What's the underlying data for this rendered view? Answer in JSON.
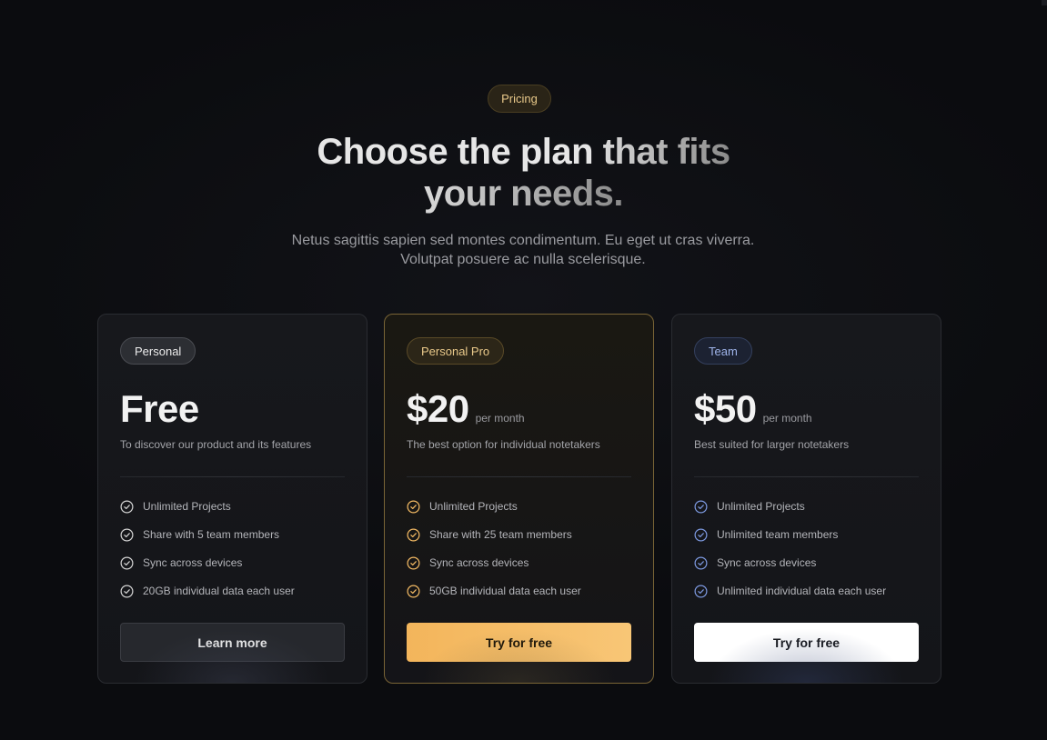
{
  "header": {
    "badge": "Pricing",
    "title_line1_plain": "Choose the plan ",
    "title_line1_fade": "that fits",
    "title_line2": "your needs.",
    "subtitle": "Netus sagittis sapien sed montes condimentum. Eu eget ut cras viverra. Volutpat posuere ac nulla scelerisque."
  },
  "colors": {
    "background": "#0b0c0f",
    "card": "#17181c",
    "gold_accent": "#f5bb64",
    "blue_accent": "#7d99e0",
    "white_check": "#d6d6d6"
  },
  "plans": [
    {
      "tag": "Personal",
      "price": "Free",
      "period": "",
      "description": "To discover our product and its features",
      "features": [
        "Unlimited Projects",
        "Share with 5 team members",
        "Sync across devices",
        "20GB individual data each user"
      ],
      "cta": "Learn more",
      "check_icon": "check-circle-icon"
    },
    {
      "tag": "Personal Pro",
      "price": "$20",
      "period": "per month",
      "description": "The best option for individual notetakers",
      "features": [
        "Unlimited Projects",
        "Share with 25 team members",
        "Sync across devices",
        "50GB individual data each user"
      ],
      "cta": "Try for free",
      "check_icon": "check-circle-icon"
    },
    {
      "tag": "Team",
      "price": "$50",
      "period": "per month",
      "description": "Best suited for larger notetakers",
      "features": [
        "Unlimited Projects",
        "Unlimited team members",
        "Sync across devices",
        "Unlimited individual data each user"
      ],
      "cta": "Try for free",
      "check_icon": "check-circle-icon"
    }
  ]
}
